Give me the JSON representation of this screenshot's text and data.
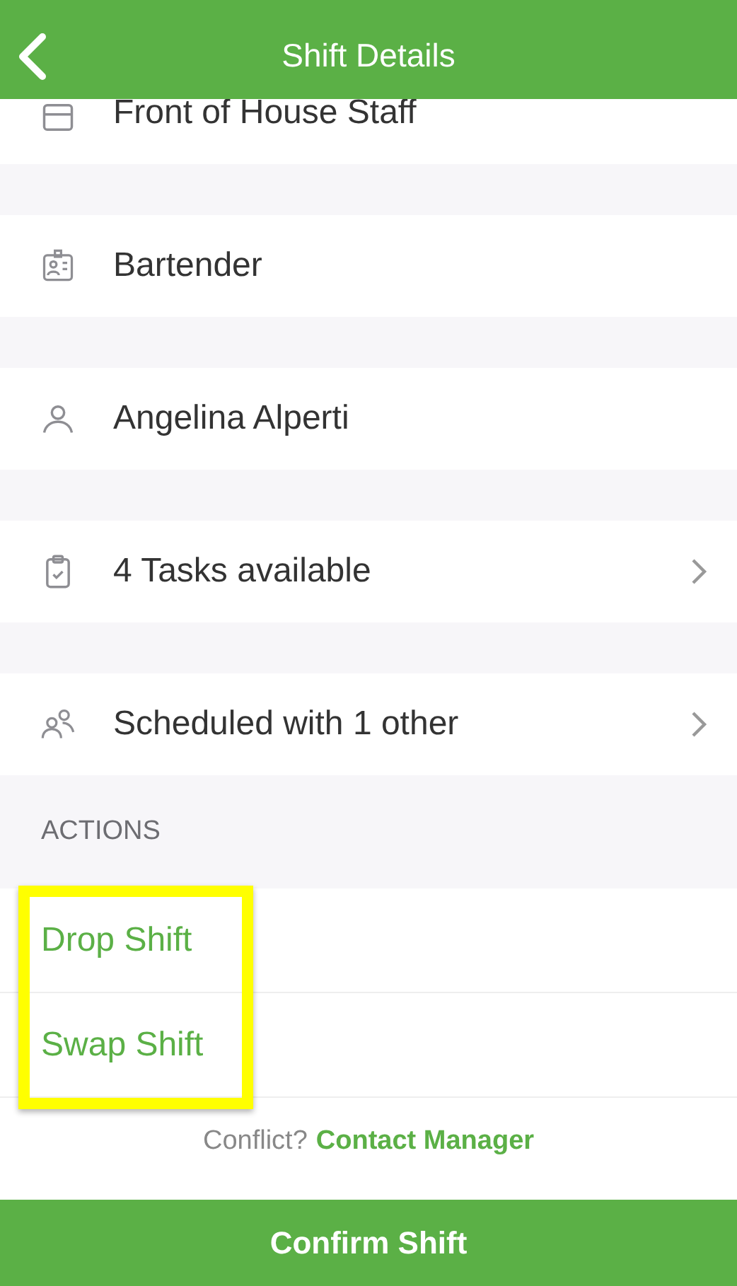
{
  "header": {
    "title": "Shift Details"
  },
  "details": [
    {
      "label": "Front of House Staff",
      "navigable": false
    },
    {
      "label": "Bartender",
      "navigable": false
    },
    {
      "label": "Angelina Alperti",
      "navigable": false
    },
    {
      "label": "4 Tasks available",
      "navigable": true
    },
    {
      "label": "Scheduled with 1 other",
      "navigable": true
    }
  ],
  "actions": {
    "heading": "ACTIONS",
    "highlighted": true,
    "items": [
      "Drop Shift",
      "Swap Shift"
    ]
  },
  "conflict": {
    "question": "Conflict?",
    "link": "Contact Manager"
  },
  "confirm_button": "Confirm Shift"
}
